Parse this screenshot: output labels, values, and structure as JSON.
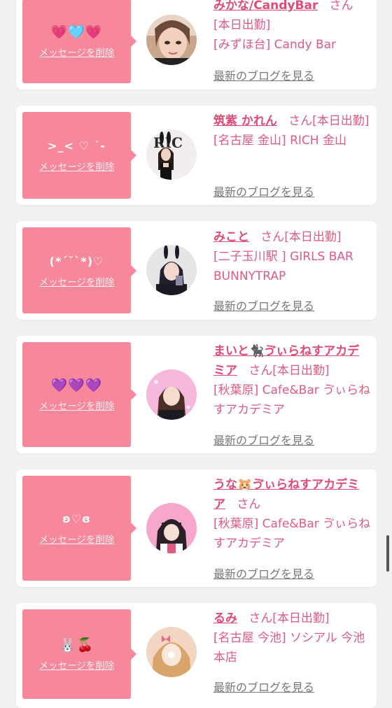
{
  "colors": {
    "accent_pink": "#f7889c",
    "name_pink": "#e04a74",
    "text_pink": "#e05a80",
    "link_gray": "#777777"
  },
  "messages": [
    {
      "emoji": "💗🩵💗",
      "delete_label": "メッセージを削除",
      "name": "みかな/CandyBar",
      "honorific": "さん",
      "status": "[本日出勤]",
      "shop": "[みずほ台] Candy Bar",
      "blog_label": "最新のブログを見る"
    },
    {
      "emoji": ">_< ♡ ˙-",
      "delete_label": "メッセージを削除",
      "name": "筑紫 かれん",
      "honorific": "さん",
      "status": "[本日出勤]",
      "shop": "[名古屋 金山] RICH 金山",
      "blog_label": "最新のブログを見る"
    },
    {
      "emoji": "(*´˘`*)♡",
      "delete_label": "メッセージを削除",
      "name": "みこと",
      "honorific": "さん",
      "status": "[本日出勤]",
      "shop": "[二子玉川駅 ] GIRLS BAR BUNNYTRAP",
      "blog_label": "最新のブログを見る"
    },
    {
      "emoji": "💜💜💜",
      "delete_label": "メッセージを削除",
      "name": "まいと🐈‍⬛ゔぃらねすアカデミア",
      "honorific": "さん",
      "status": "[本日出勤]",
      "shop": "[秋葉原] Cafe&Bar ゔぃらねすアカデミア",
      "blog_label": "最新のブログを見る"
    },
    {
      "emoji": "ʚ♡ɞ",
      "delete_label": "メッセージを削除",
      "name": "うな🐹ゔぃらねすアカデミア",
      "honorific": "さん",
      "status": "",
      "shop": "[秋葉原] Cafe&Bar ゔぃらねすアカデミア",
      "blog_label": "最新のブログを見る"
    },
    {
      "emoji": "🐰🍒",
      "delete_label": "メッセージを削除",
      "name": "るみ",
      "honorific": "さん",
      "status": "[本日出勤]",
      "shop": "[名古屋 今池] ソシアル 今池本店",
      "blog_label": "最新のブログを見る"
    }
  ]
}
